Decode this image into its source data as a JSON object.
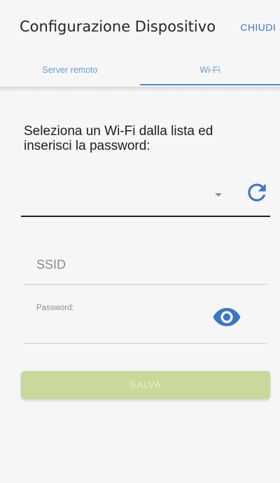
{
  "header": {
    "title": "Configurazione Dispositivo",
    "close_label": "CHIUDI"
  },
  "tabs": [
    {
      "label": "Server remoto",
      "active": false
    },
    {
      "label": "Wi-Fi",
      "active": true
    }
  ],
  "wifi": {
    "instruction": "Seleziona un Wi-Fi dalla lista ed inserisci la password:",
    "selected_network": "",
    "refresh_icon": "refresh-icon",
    "ssid_placeholder": "SSID",
    "password_label": "Password:",
    "visibility_icon": "eye-icon",
    "save_label": "SALVA"
  },
  "colors": {
    "accent": "#3a78c5",
    "tab_text": "#6e9ad3",
    "save_button": "#c8d99a",
    "background": "#f6f6f6"
  }
}
